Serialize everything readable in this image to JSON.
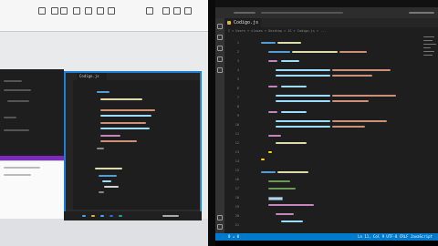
{
  "editor": {
    "tab_label": "Codigo.js",
    "breadcrumb": "C > Users > clases > Desktop > JS > Codigo.js > ...",
    "status_left": "0 ⚠ 0",
    "status_right": "Ln 11, Col 9   UTF-8   CRLF   JavaScript"
  },
  "mid_editor": {
    "tab_label": "Codigo.js"
  },
  "colors": {
    "accent": "#007acc",
    "border_blue": "#1e7fd6",
    "purple": "#7d2bbd"
  }
}
